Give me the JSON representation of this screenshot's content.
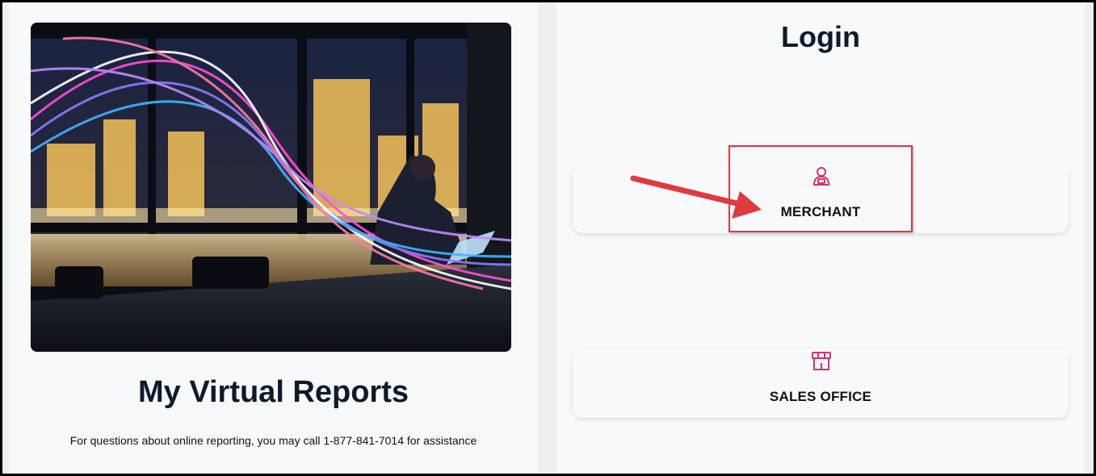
{
  "brand": {
    "title": "My Virtual Reports",
    "help_text": "For questions about online reporting, you may call 1-877-841-7014 for assistance"
  },
  "login": {
    "title": "Login",
    "options": [
      {
        "label": "MERCHANT",
        "icon": "user-icon"
      },
      {
        "label": "SALES OFFICE",
        "icon": "storefront-icon"
      }
    ]
  },
  "colors": {
    "accent": "#d6336c",
    "annotation": "#e0393e",
    "title": "#0d1b2a"
  }
}
